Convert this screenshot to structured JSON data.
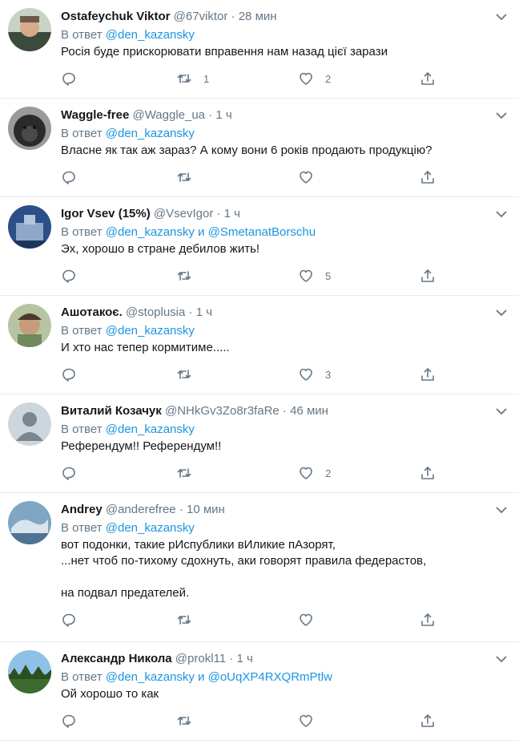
{
  "colors": {
    "link": "#1b95e0",
    "secondary": "#657786",
    "border": "#e6ecf0"
  },
  "icons": {
    "reply": "reply-icon",
    "retweet": "retweet-icon",
    "like": "heart-icon",
    "share": "share-icon",
    "menu": "chevron-down-icon"
  },
  "tweets": [
    {
      "name": "Ostafeychuk Viktor",
      "handle": "@67viktor",
      "time": "28 мин",
      "reply_prefix": "В ответ",
      "mention1": "@den_kazansky",
      "conj": "",
      "mention2": "",
      "text": "Росія буде прискорювати вправення нам назад цієї зарази",
      "retweets": "1",
      "likes": "2"
    },
    {
      "name": "Waggle-free",
      "handle": "@Waggle_ua",
      "time": "1 ч",
      "reply_prefix": "В ответ",
      "mention1": "@den_kazansky",
      "conj": "",
      "mention2": "",
      "text": "Власне як так аж зараз? А кому вони 6 років продають продукцію?",
      "retweets": "",
      "likes": ""
    },
    {
      "name": "Igor Vsev (15%)",
      "handle": "@VsevIgor",
      "time": "1 ч",
      "reply_prefix": "В ответ",
      "mention1": "@den_kazansky",
      "conj": "и",
      "mention2": "@SmetanatBorschu",
      "text": "Эх, хорошо в стране дебилов жить!",
      "retweets": "",
      "likes": "5"
    },
    {
      "name": "Ашотакоє.",
      "handle": "@stoplusia",
      "time": "1 ч",
      "reply_prefix": "В ответ",
      "mention1": "@den_kazansky",
      "conj": "",
      "mention2": "",
      "text": "И хто нас тепер кормитиме.....",
      "retweets": "",
      "likes": "3"
    },
    {
      "name": "Виталий Козачук",
      "handle": "@NHkGv3Zo8r3faRe",
      "time": "46 мин",
      "reply_prefix": "В ответ",
      "mention1": "@den_kazansky",
      "conj": "",
      "mention2": "",
      "text": "Референдум!! Референдум!!",
      "retweets": "",
      "likes": "2"
    },
    {
      "name": "Andrey",
      "handle": "@anderefree",
      "time": "10 мин",
      "reply_prefix": "В ответ",
      "mention1": "@den_kazansky",
      "conj": "",
      "mention2": "",
      "text": "вот подонки, такие рИспублики вИликие пАзорят,\n...нет чтоб по-тихому сдохнуть, аки говорят правила федерастов,\n\nна подвал предателей.",
      "retweets": "",
      "likes": ""
    },
    {
      "name": "Александр Никола",
      "handle": "@prokl11",
      "time": "1 ч",
      "reply_prefix": "В ответ",
      "mention1": "@den_kazansky",
      "conj": "и",
      "mention2": "@oUqXP4RXQRmPtlw",
      "text": "Ой хорошо то как",
      "retweets": "",
      "likes": ""
    }
  ]
}
